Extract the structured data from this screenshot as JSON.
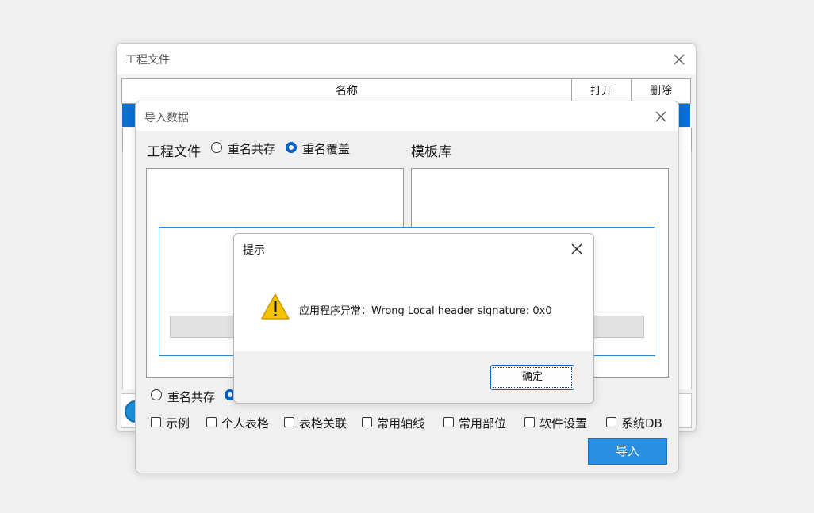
{
  "project_window": {
    "title": "工程文件",
    "columns": {
      "name": "名称",
      "open": "打开",
      "delete": "删除"
    }
  },
  "import_window": {
    "title": "导入数据",
    "section_project": "工程文件",
    "radio_keep_both": "重名共存",
    "radio_overwrite": "重名覆盖",
    "section_template": "模板库",
    "bottom_radio_keep_both": "重名共存",
    "checkboxes": [
      "示例",
      "个人表格",
      "表格关联",
      "常用轴线",
      "常用部位",
      "软件设置",
      "系统DB"
    ],
    "import_button": "导入"
  },
  "alert_dialog": {
    "title": "提示",
    "message": "应用程序异常：Wrong Local header signature: 0x0",
    "ok_button": "确定"
  },
  "colors": {
    "accent": "#0a6fd6",
    "selection": "#0a6fd6",
    "button_blue": "#2b8fe0",
    "warning": "#f5c400"
  }
}
